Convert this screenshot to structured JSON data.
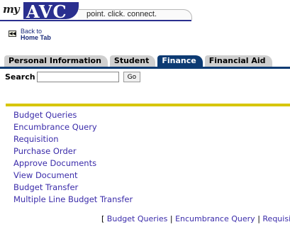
{
  "header": {
    "logo_prefix": "my",
    "logo_main": "AVC",
    "tagline": "point. click. connect."
  },
  "back": {
    "line1": "Back to",
    "line2": "Home Tab"
  },
  "tabs": [
    {
      "label": "Personal Information"
    },
    {
      "label": "Student"
    },
    {
      "label": "Finance"
    },
    {
      "label": "Financial Aid"
    }
  ],
  "search": {
    "label": "Search",
    "value": "",
    "button": "Go"
  },
  "links": [
    {
      "label": "Budget Queries"
    },
    {
      "label": "Encumbrance Query"
    },
    {
      "label": "Requisition"
    },
    {
      "label": "Purchase Order"
    },
    {
      "label": "Approve Documents"
    },
    {
      "label": "View Document"
    },
    {
      "label": "Budget Transfer"
    },
    {
      "label": "Multiple Line Budget Transfer"
    }
  ],
  "footer": {
    "open_bracket": "[",
    "separator": "|",
    "items": [
      "Budget Queries",
      "Encumbrance Query",
      "Requisi"
    ]
  },
  "colors": {
    "tab_active": "#0d3b73",
    "link": "#3b2caa",
    "gold_rule": "#d7c600",
    "logo_blue": "#2a2f8f"
  }
}
